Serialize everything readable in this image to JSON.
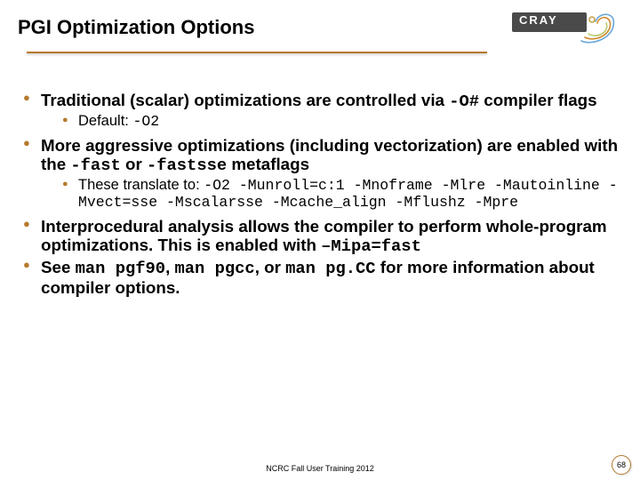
{
  "header": {
    "title": "PGI Optimization Options",
    "logo_text": "CRAY"
  },
  "bullets": {
    "b1": {
      "t1": "Traditional (scalar) optimizations are controlled via ",
      "code1": "-O#",
      "t2": " compiler flags",
      "sub": {
        "t1": "Default: ",
        "code1": "-O2"
      }
    },
    "b2": {
      "t1": "More aggressive optimizations (including vectorization) are enabled with the ",
      "code1": "-fast",
      "t2": " or ",
      "code2": "-fastsse",
      "t3": " metaflags",
      "sub": {
        "t1": "These translate to: ",
        "code1": "-O2 -Munroll=c:1 -Mnoframe -Mlre -Mautoinline  -Mvect=sse -Mscalarsse -Mcache_align -Mflushz -Mpre"
      }
    },
    "b3": {
      "t1": "Interprocedural analysis allows the compiler to perform whole-program optimizations.  This is enabled with ",
      "code1": "–Mipa=fast"
    },
    "b4": {
      "t1": "See ",
      "code1": "man pgf90",
      "t2": ", ",
      "code2": "man pgcc",
      "t3": ", or ",
      "code3": "man pg.CC",
      "t4": " for more information about compiler options."
    }
  },
  "footer": {
    "text": "NCRC Fall User Training 2012",
    "page": "68"
  }
}
